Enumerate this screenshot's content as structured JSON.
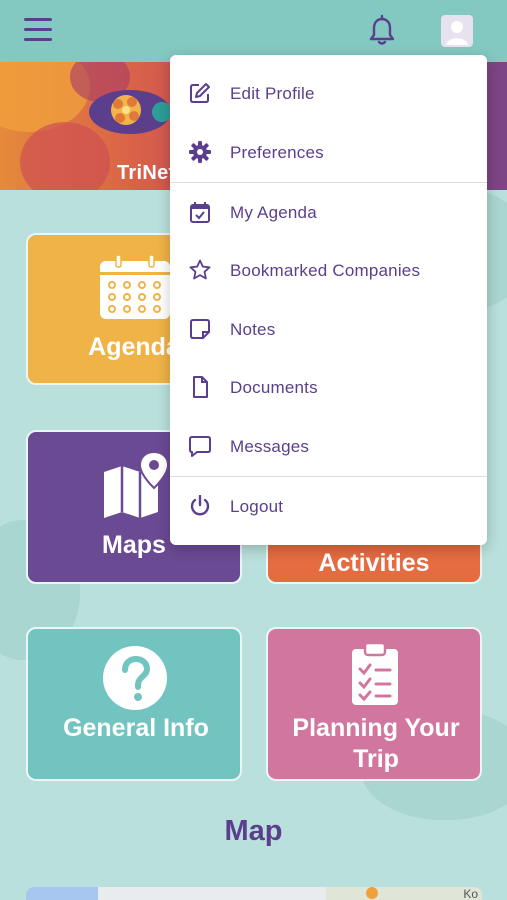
{
  "banner": {
    "text": "TriNet"
  },
  "tiles": [
    {
      "label": "Agenda"
    },
    {
      "label": "Maps"
    },
    {
      "label": "Activities"
    },
    {
      "label": "General Info"
    },
    {
      "label": "Planning Your Trip"
    }
  ],
  "section": {
    "title": "Map"
  },
  "map_preview": {
    "label": "Ko"
  },
  "icons": {
    "menu": "hamburger-icon",
    "notifications": "bell-icon",
    "profile": "avatar-icon",
    "edit": "edit-icon",
    "preferences": "gear-icon",
    "agenda": "calendar-check-icon",
    "bookmark": "star-icon",
    "notes": "note-icon",
    "documents": "document-icon",
    "messages": "message-icon",
    "logout": "power-icon"
  },
  "colors": {
    "primary": "#5b3f8c",
    "topbar": "#84c8c2",
    "background": "#b9e0dc",
    "agenda_tile": "#efb347",
    "maps_tile": "#6b4a94",
    "activities_tile": "#e56c40",
    "general_tile": "#72c4c0",
    "planning_tile": "#d1779f"
  },
  "dropdown": {
    "items": [
      {
        "label": "Edit Profile"
      },
      {
        "label": "Preferences"
      },
      {
        "label": "My Agenda"
      },
      {
        "label": "Bookmarked Companies"
      },
      {
        "label": "Notes"
      },
      {
        "label": "Documents"
      },
      {
        "label": "Messages"
      },
      {
        "label": "Logout"
      }
    ]
  }
}
